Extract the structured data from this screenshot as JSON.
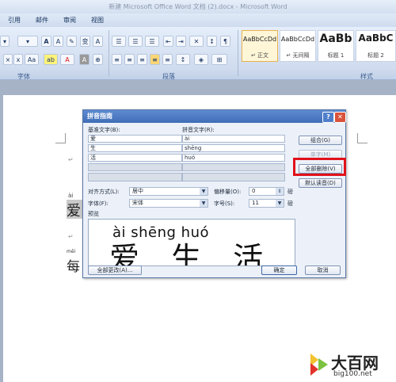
{
  "window": {
    "title": "新建 Microsoft Office Word 文档 (2).docx - Microsoft Word"
  },
  "menu": [
    "引用",
    "邮件",
    "审阅",
    "视图"
  ],
  "ribbon": {
    "font_group_label": "字体",
    "paragraph_group_label": "段落",
    "styles_group_label": "样式",
    "styles": [
      {
        "sample": "AaBbCcDd",
        "name": "↵ 正文"
      },
      {
        "sample": "AaBbCcDd",
        "name": "↵ 无间隔"
      },
      {
        "sample": "AaBb",
        "name": "标题 1"
      },
      {
        "sample": "AaBbC",
        "name": "标题 2"
      }
    ]
  },
  "document": {
    "ruby_1": "ài",
    "char_1": "爱",
    "ruby_2": "měi",
    "char_2": "每"
  },
  "dialog": {
    "title": "拼音指南",
    "base_text_label": "基准文字(B):",
    "ruby_text_label": "拼音文字(R):",
    "rows": [
      {
        "base": "爱",
        "ruby": "ài"
      },
      {
        "base": "生",
        "ruby": "shēng"
      },
      {
        "base": "活",
        "ruby": "huó"
      }
    ],
    "buttons": {
      "combine": "组合(G)",
      "single": "单字(M)",
      "clear_all": "全部删除(V)",
      "default_reading": "默认读音(D)",
      "change_all": "全部更改(A)...",
      "ok": "确定",
      "cancel": "取消"
    },
    "alignment_label": "对齐方式(L):",
    "alignment_value": "居中",
    "offset_label": "偏移量(O):",
    "offset_value": "0",
    "offset_unit": "磅",
    "font_label": "字体(F):",
    "font_value": "宋体",
    "size_label": "字号(S):",
    "size_value": "11",
    "size_unit": "磅",
    "preview_label": "预览",
    "preview_pinyin": "ài shēng huó",
    "preview_chars": "爱 生 活"
  },
  "watermark": {
    "name": "大百网",
    "url": "big100.net"
  }
}
